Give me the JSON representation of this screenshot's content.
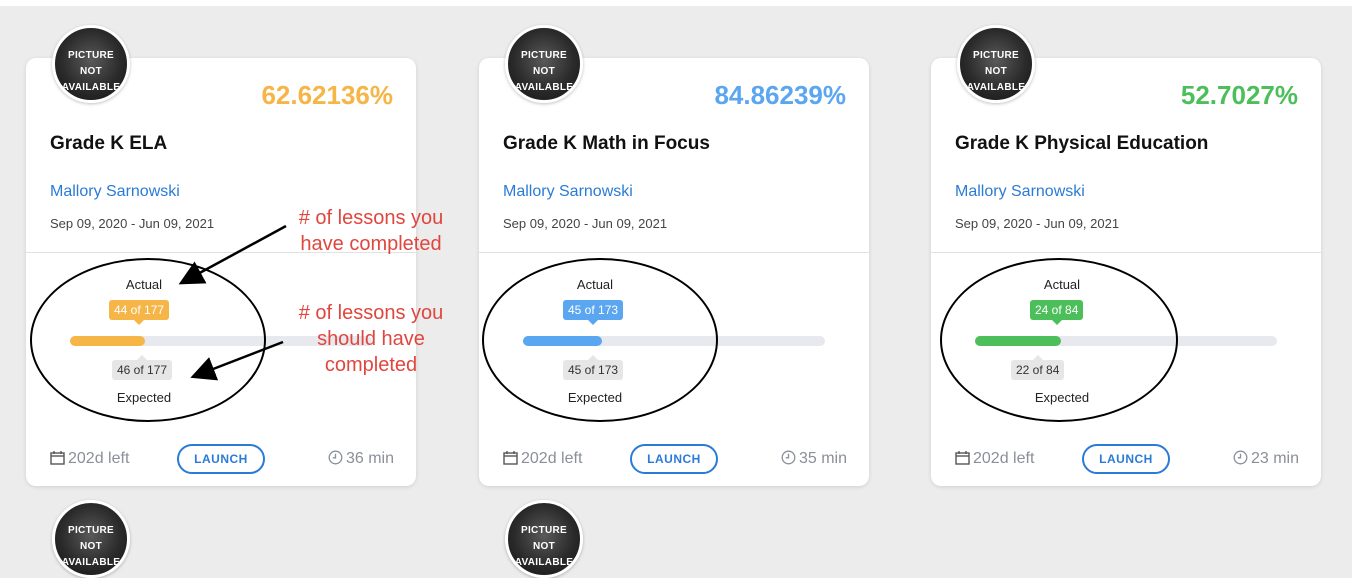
{
  "avatar_text": [
    "PICTURE",
    "NOT",
    "AVAILABLE"
  ],
  "courses": [
    {
      "percent": "62.62136%",
      "color": "#f5b547",
      "title": "Grade K ELA",
      "teacher": "Mallory Sarnowski",
      "dates": "Sep 09, 2020 - Jun 09, 2021",
      "actual_label": "Actual",
      "actual": "44 of 177",
      "actual_fraction": 0.2486,
      "expected": "46 of 177",
      "expected_label": "Expected",
      "days_left": "202d left",
      "launch": "LAUNCH",
      "duration": "36 min"
    },
    {
      "percent": "84.86239%",
      "color": "#5aa6f0",
      "title": "Grade K Math in Focus",
      "teacher": "Mallory Sarnowski",
      "dates": "Sep 09, 2020 - Jun 09, 2021",
      "actual_label": "Actual",
      "actual": "45 of 173",
      "actual_fraction": 0.2601,
      "expected": "45 of 173",
      "expected_label": "Expected",
      "days_left": "202d left",
      "launch": "LAUNCH",
      "duration": "35 min"
    },
    {
      "percent": "52.7027%",
      "color": "#4dbf5a",
      "title": "Grade K Physical Education",
      "teacher": "Mallory Sarnowski",
      "dates": "Sep 09, 2020 - Jun 09, 2021",
      "actual_label": "Actual",
      "actual": "24 of 84",
      "actual_fraction": 0.2857,
      "expected": "22 of 84",
      "expected_label": "Expected",
      "days_left": "202d left",
      "launch": "LAUNCH",
      "duration": "23 min"
    }
  ],
  "annotations": {
    "completed": [
      "# of lessons you",
      "have completed"
    ],
    "should": [
      "# of lessons you",
      "should have",
      "completed"
    ],
    "color": "#e0463e"
  }
}
